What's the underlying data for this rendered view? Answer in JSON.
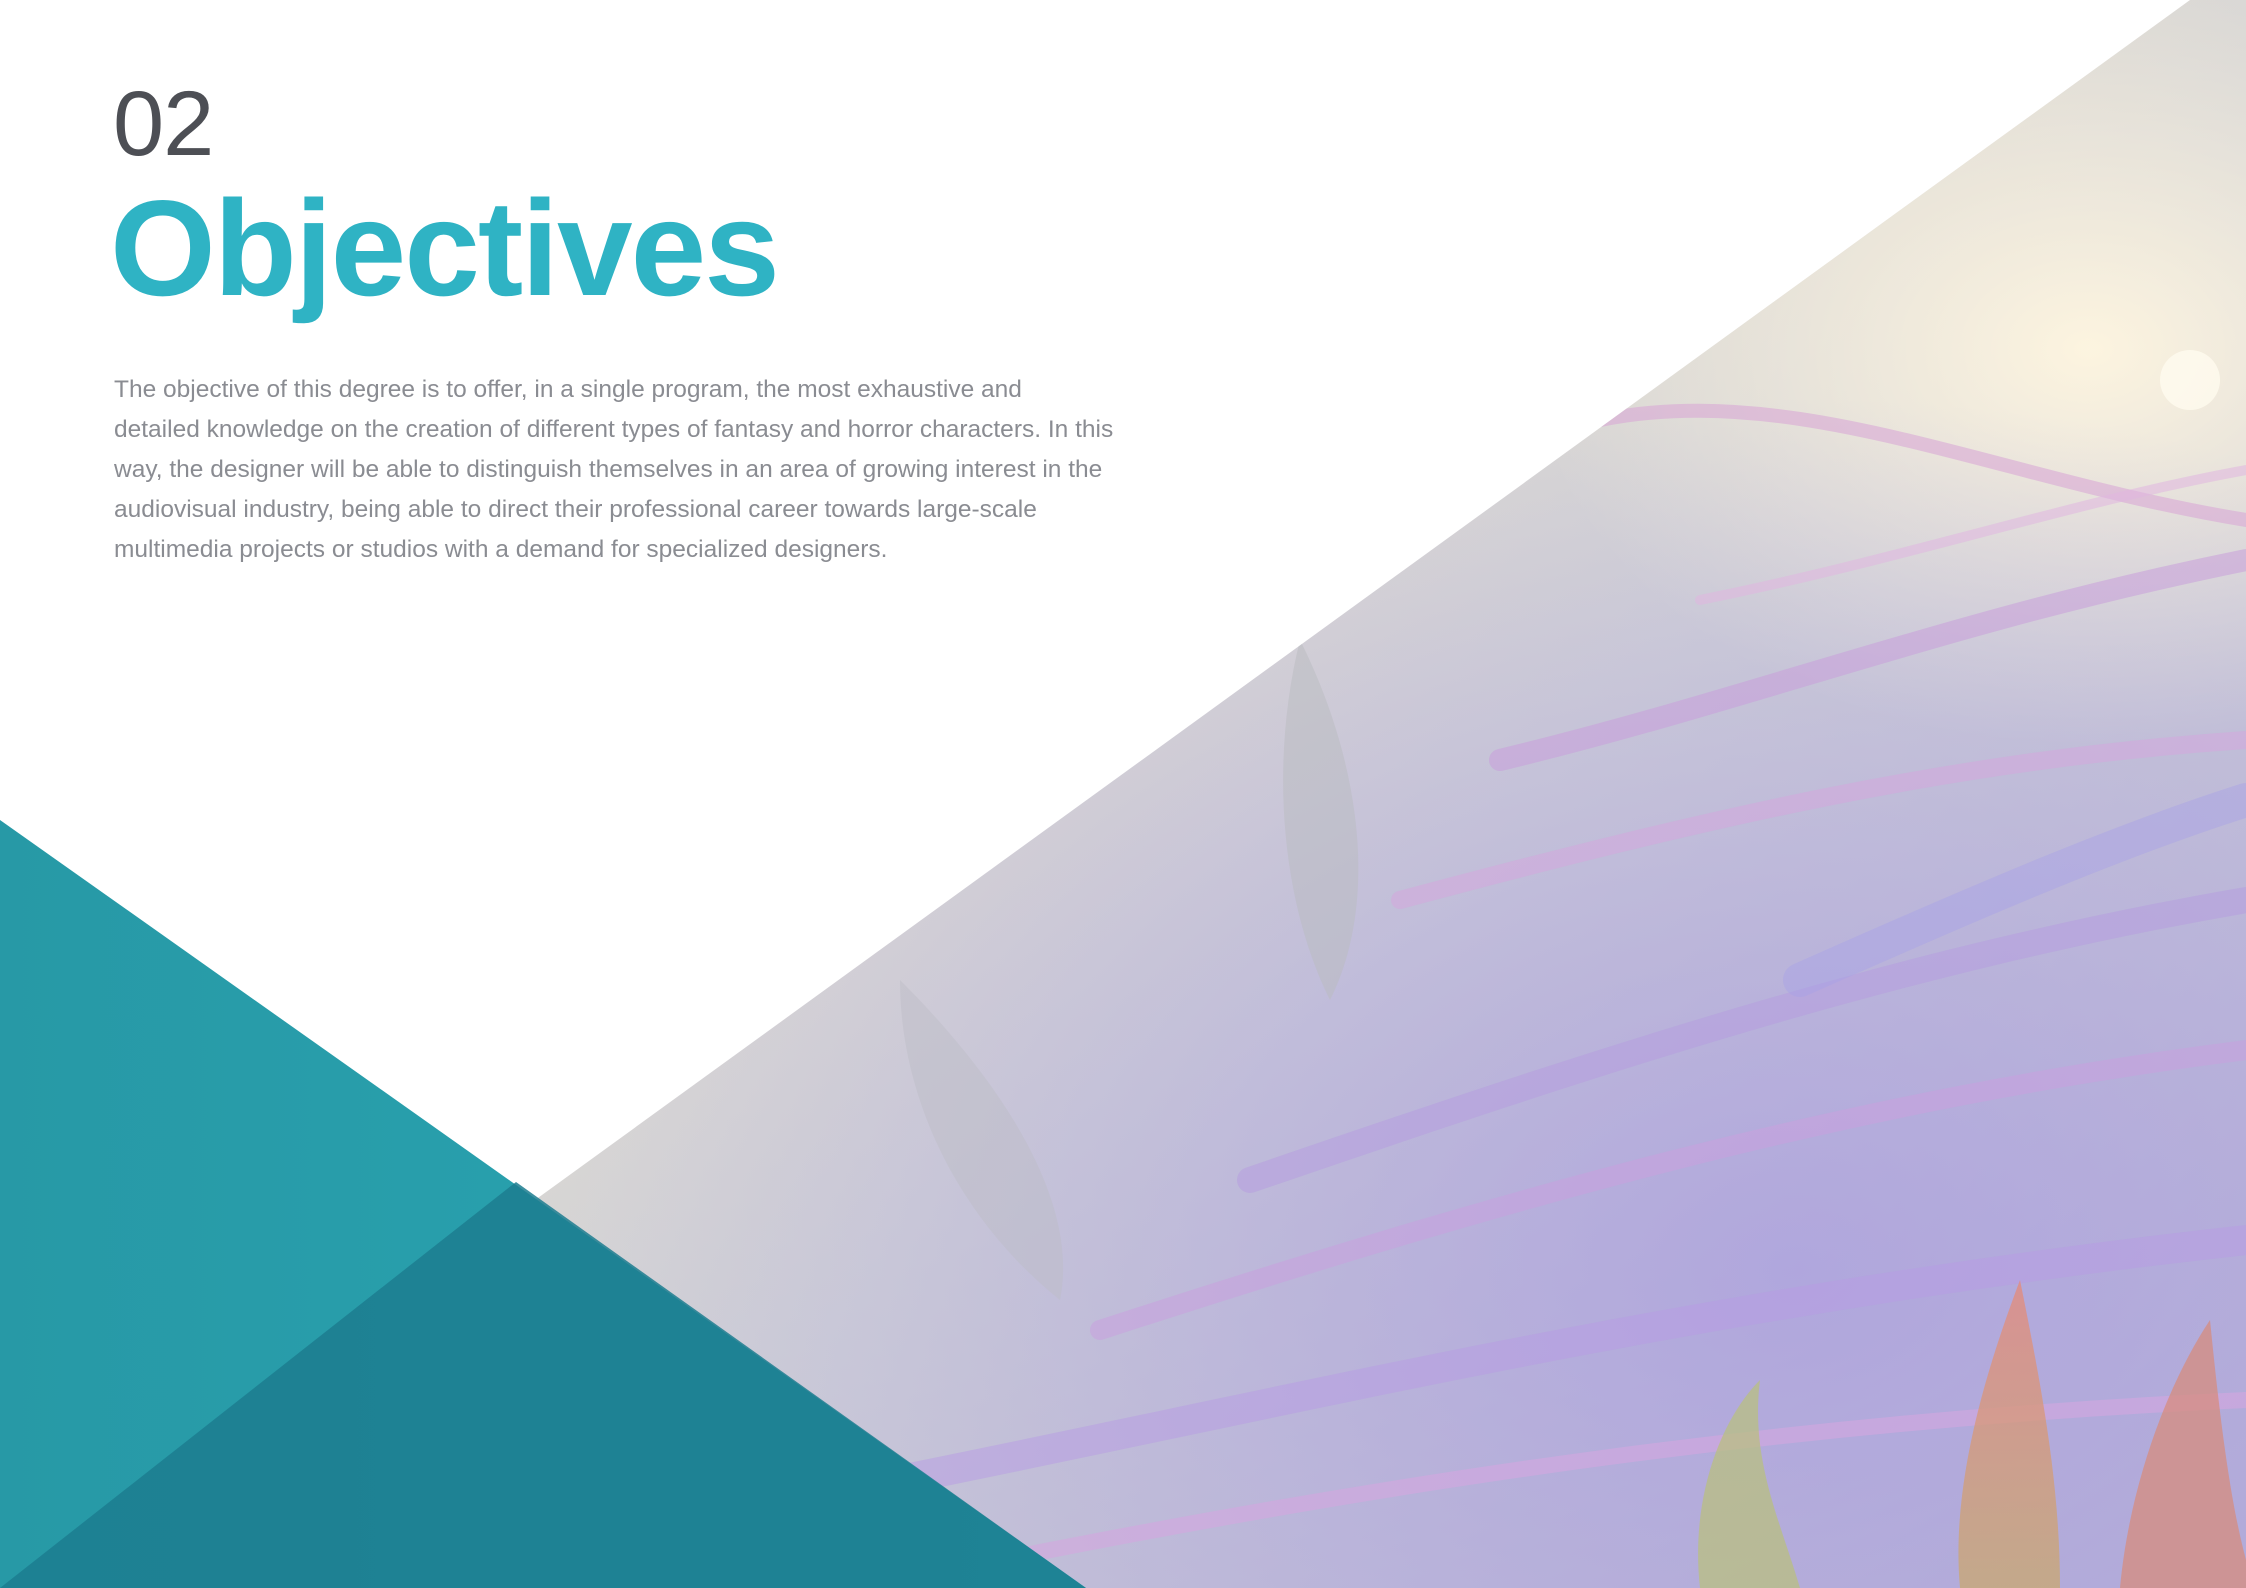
{
  "section": {
    "number": "02",
    "title": "Objectives"
  },
  "body": {
    "paragraph": "The objective of this degree is to offer, in a single program, the most exhaustive and detailed knowledge on the creation of different types of fantasy and horror characters. In this way, the designer will be able to distinguish themselves in an area of growing interest in the audiovisual industry, being able to direct their professional career towards large-scale multimedia projects or studios with a demand for specialized designers."
  },
  "colors": {
    "accent": "#2fb3c4",
    "teal_dark": "#1e7f8f",
    "number_gray": "#4d4f55",
    "text_gray": "#8a8c92"
  },
  "decoration": {
    "artwork_icon": "fantasy-hair-artwork"
  }
}
